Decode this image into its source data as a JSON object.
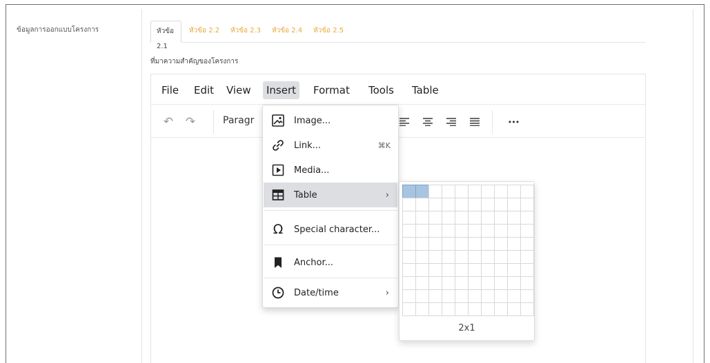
{
  "section_label": "ข้อมูลการออกแบบโครงการ",
  "tabs": [
    {
      "label": "หัวข้อ 2.1",
      "active": true
    },
    {
      "label": "หัวข้อ 2.2",
      "active": false
    },
    {
      "label": "หัวข้อ 2.3",
      "active": false
    },
    {
      "label": "หัวข้อ 2.4",
      "active": false
    },
    {
      "label": "หัวข้อ 2.5",
      "active": false
    }
  ],
  "field_label": "ที่มาความสำคัญของโครงการ",
  "menubar": {
    "items": [
      "File",
      "Edit",
      "View",
      "Insert",
      "Format",
      "Tools",
      "Table"
    ],
    "open": "Insert"
  },
  "toolbar": {
    "paragraph_label": "Paragr",
    "more_label": "•••"
  },
  "insert_menu": {
    "items": [
      {
        "label": "Image...",
        "icon": "image-icon"
      },
      {
        "label": "Link...",
        "icon": "link-icon",
        "shortcut": "⌘K"
      },
      {
        "label": "Media...",
        "icon": "media-icon"
      },
      {
        "label": "Table",
        "icon": "table-icon",
        "submenu": true,
        "hover": true
      },
      {
        "label": "Special character...",
        "icon": "omega-icon"
      },
      {
        "label": "Anchor...",
        "icon": "bookmark-icon"
      },
      {
        "label": "Date/time",
        "icon": "clock-icon",
        "submenu": true
      }
    ],
    "submenu_arrow": "›"
  },
  "table_picker": {
    "selected_size": "2x1",
    "rows": 10,
    "cols": 10,
    "selected_rows": 1,
    "selected_cols": 2
  },
  "colors": {
    "tab_inactive": "#e8a83a",
    "hover_bg": "#dcdee2",
    "grid_selected": "#a7c4e0"
  }
}
